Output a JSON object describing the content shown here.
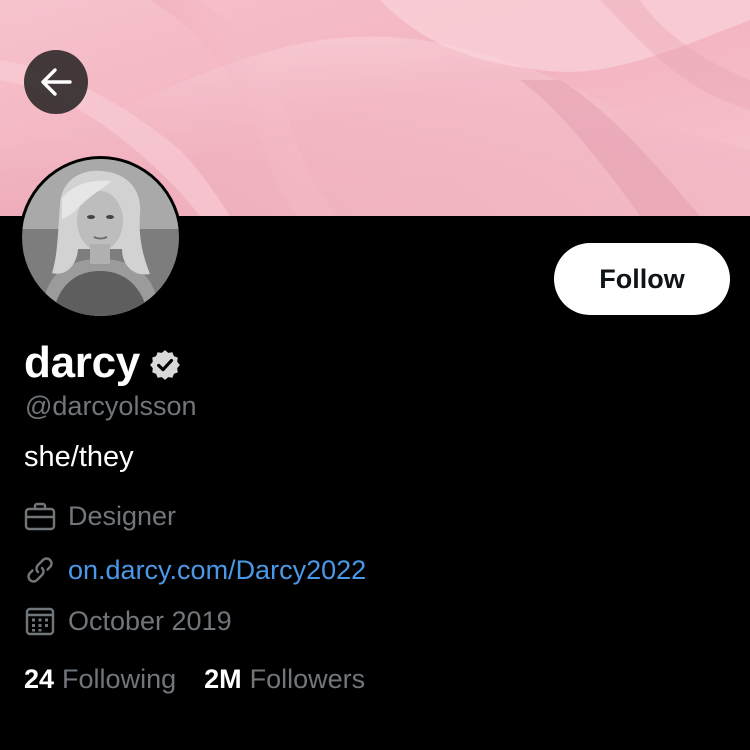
{
  "header": {
    "back_icon": "arrow-left-icon"
  },
  "profile": {
    "display_name": "darcy",
    "verified_icon": "verified-badge-icon",
    "handle": "@darcyolsson",
    "bio": "she/they",
    "follow_label": "Follow",
    "job": {
      "icon": "briefcase-icon",
      "text": "Designer"
    },
    "website": {
      "icon": "link-icon",
      "text": "on.darcy.com/Darcy2022"
    },
    "joined": {
      "icon": "calendar-icon",
      "text": "October 2019"
    },
    "stats": {
      "following_count": "24",
      "following_label": "Following",
      "followers_count": "2M",
      "followers_label": "Followers"
    }
  },
  "colors": {
    "background": "#000000",
    "banner": "#f4b8c4",
    "secondary_text": "#71767b",
    "link": "#4a99e9",
    "follow_bg": "#ffffff"
  }
}
